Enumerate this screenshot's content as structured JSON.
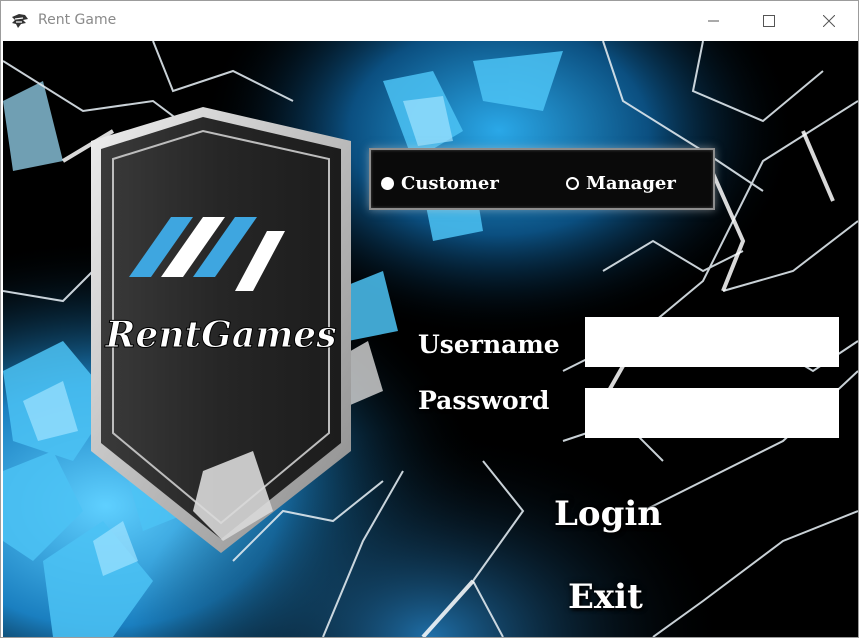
{
  "window": {
    "title": "Rent Game"
  },
  "logo": {
    "text": "RentGames"
  },
  "role": {
    "options": [
      {
        "label": "Customer",
        "selected": true
      },
      {
        "label": "Manager",
        "selected": false
      }
    ]
  },
  "form": {
    "username_label": "Username",
    "username_value": "",
    "password_label": "Password",
    "password_value": ""
  },
  "actions": {
    "login": "Login",
    "exit": "Exit"
  },
  "colors": {
    "accent_blue": "#3ea6e0",
    "background": "#000000",
    "shield_dark": "#2b2b2b",
    "text": "#ffffff"
  }
}
